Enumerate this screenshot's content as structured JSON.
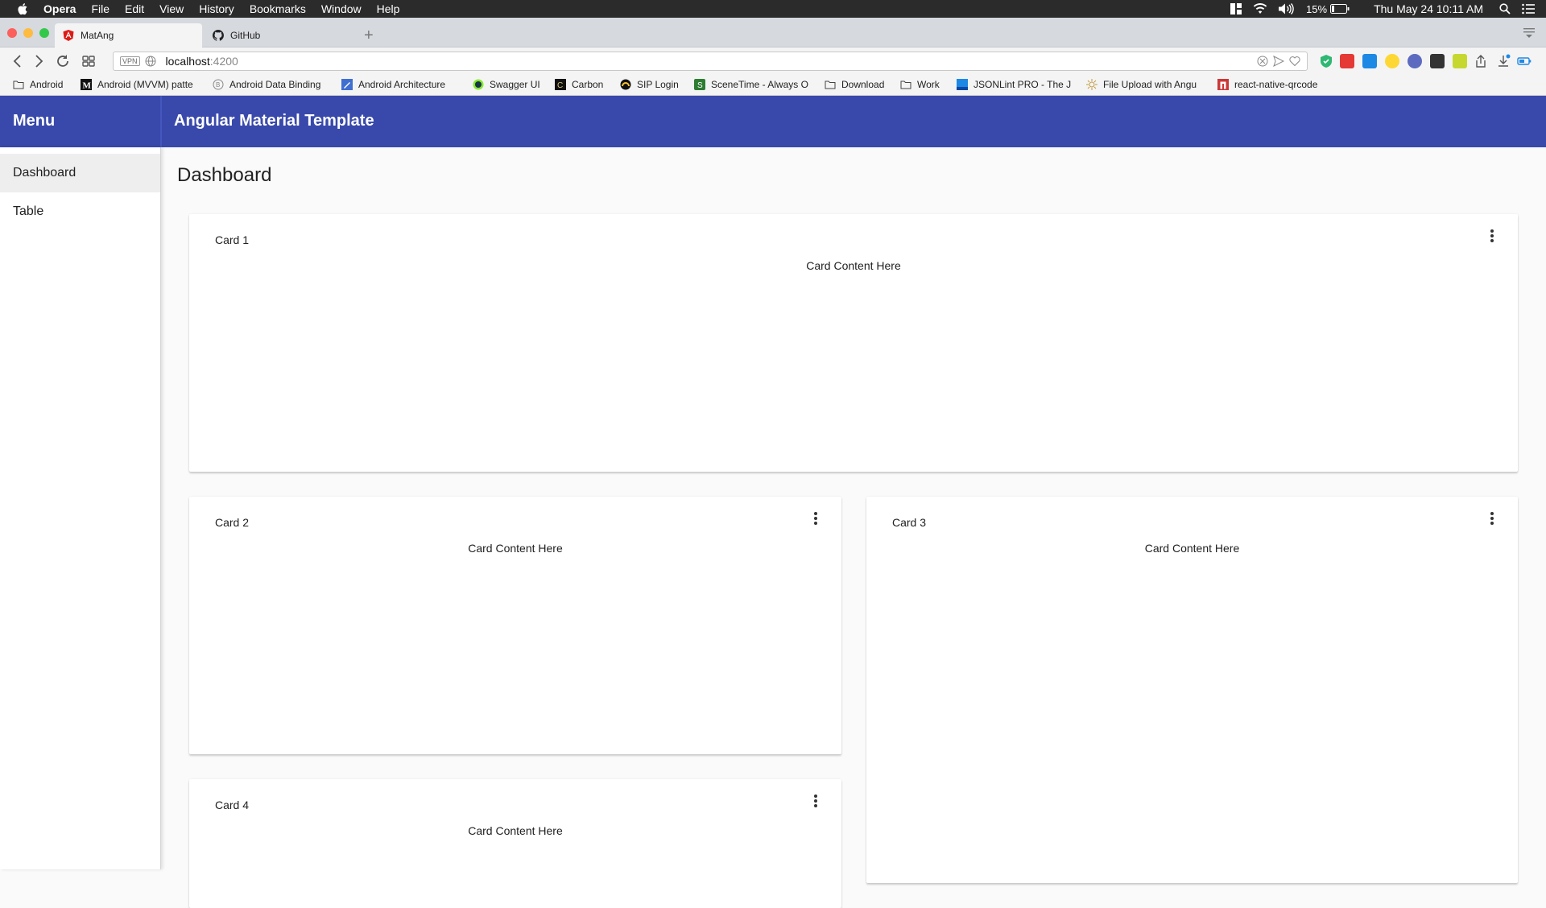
{
  "menubar": {
    "app_name": "Opera",
    "items": [
      "File",
      "Edit",
      "View",
      "History",
      "Bookmarks",
      "Window",
      "Help"
    ],
    "battery": "15%",
    "datetime": "Thu May 24  10:11 AM"
  },
  "tabs": [
    {
      "title": "MatAng",
      "icon": "angular-icon"
    },
    {
      "title": "GitHub",
      "icon": "github-icon"
    }
  ],
  "address": {
    "vpn_badge": "VPN",
    "host": "localhost",
    "port": ":4200"
  },
  "bookmarks": [
    {
      "label": "Android",
      "icon": "folder-icon"
    },
    {
      "label": "Android (MVVM) patte",
      "icon": "medium-icon"
    },
    {
      "label": "Android Data Binding",
      "icon": "generic-icon"
    },
    {
      "label": "Android Architecture",
      "icon": "pen-icon"
    },
    {
      "label": "Swagger UI",
      "icon": "swagger-icon"
    },
    {
      "label": "Carbon",
      "icon": "carbon-icon"
    },
    {
      "label": "SIP Login",
      "icon": "sip-icon"
    },
    {
      "label": "SceneTime - Always O",
      "icon": "scenetime-icon"
    },
    {
      "label": "Download",
      "icon": "folder-icon"
    },
    {
      "label": "Work",
      "icon": "folder-icon"
    },
    {
      "label": "JSONLint PRO - The J",
      "icon": "jsonlint-icon"
    },
    {
      "label": "File Upload with Angu",
      "icon": "sun-icon"
    },
    {
      "label": "react-native-qrcode",
      "icon": "npm-icon"
    }
  ],
  "toolbar": {
    "menu_title": "Menu",
    "app_title": "Angular Material Template"
  },
  "sidenav": {
    "items": [
      {
        "label": "Dashboard",
        "active": true
      },
      {
        "label": "Table",
        "active": false
      }
    ]
  },
  "main": {
    "title": "Dashboard",
    "cards": [
      {
        "title": "Card 1",
        "content": "Card Content Here"
      },
      {
        "title": "Card 2",
        "content": "Card Content Here"
      },
      {
        "title": "Card 3",
        "content": "Card Content Here"
      },
      {
        "title": "Card 4",
        "content": "Card Content Here"
      }
    ]
  },
  "colors": {
    "primary": "#3949ab",
    "background": "#fafafa",
    "traffic_red": "#fc605c",
    "traffic_yellow": "#fdbc40",
    "traffic_green": "#34c84a"
  }
}
